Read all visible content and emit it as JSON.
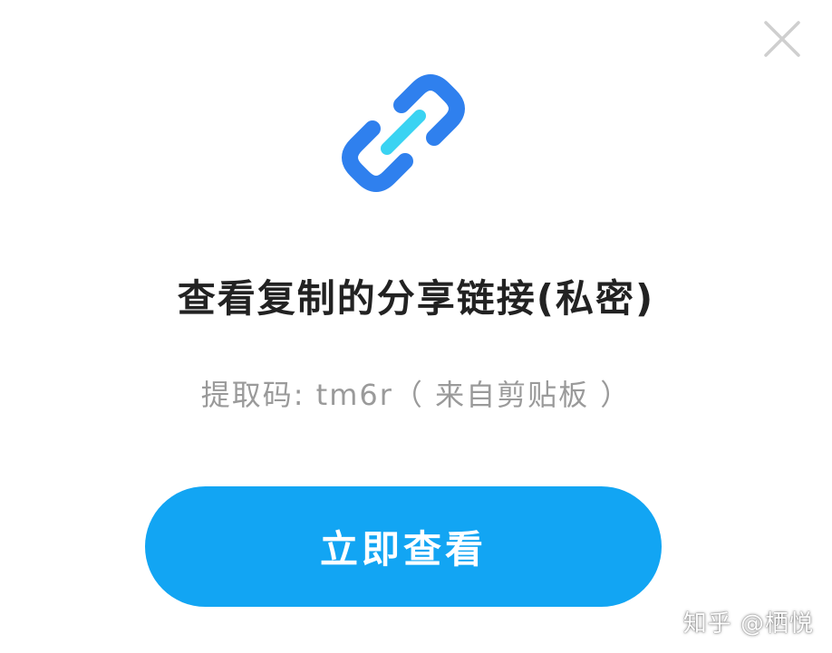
{
  "dialog": {
    "close_icon": "close-icon",
    "link_icon": "link-icon",
    "title": "查看复制的分享链接(私密)",
    "subtitle": "提取码: tm6r（ 来自剪贴板 ）",
    "primary_button": "立即查看"
  },
  "watermark": "知乎 @栖悦",
  "colors": {
    "accent": "#12a5f3",
    "icon_blue": "#2f80ee",
    "icon_cyan": "#3ad3f2",
    "close_gray": "#cfcfcf",
    "title": "#222222",
    "subtitle": "#9a9a9a"
  }
}
